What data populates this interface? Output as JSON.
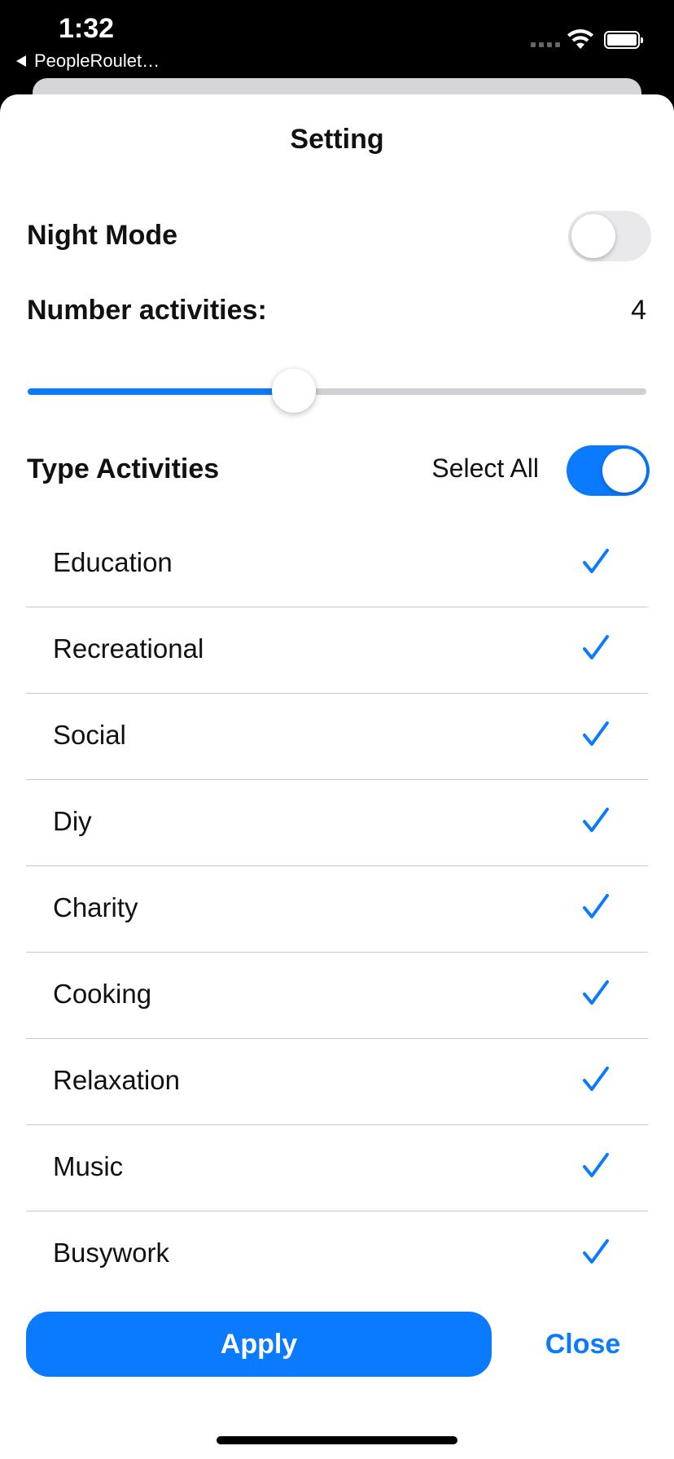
{
  "status_bar": {
    "time": "1:32",
    "back_app": "PeopleRoulet…"
  },
  "sheet": {
    "title": "Setting"
  },
  "night_mode": {
    "label": "Night Mode",
    "enabled": false
  },
  "activities_count": {
    "label": "Number activities:",
    "value": "4",
    "slider_fraction": 0.43
  },
  "type_activities": {
    "label": "Type Activities",
    "select_all_label": "Select All",
    "select_all_enabled": true,
    "items": [
      {
        "label": "Education",
        "checked": true
      },
      {
        "label": "Recreational",
        "checked": true
      },
      {
        "label": "Social",
        "checked": true
      },
      {
        "label": "Diy",
        "checked": true
      },
      {
        "label": "Charity",
        "checked": true
      },
      {
        "label": "Cooking",
        "checked": true
      },
      {
        "label": "Relaxation",
        "checked": true
      },
      {
        "label": "Music",
        "checked": true
      },
      {
        "label": "Busywork",
        "checked": true
      }
    ]
  },
  "actions": {
    "apply_label": "Apply",
    "close_label": "Close"
  },
  "colors": {
    "accent": "#0a7aff"
  }
}
